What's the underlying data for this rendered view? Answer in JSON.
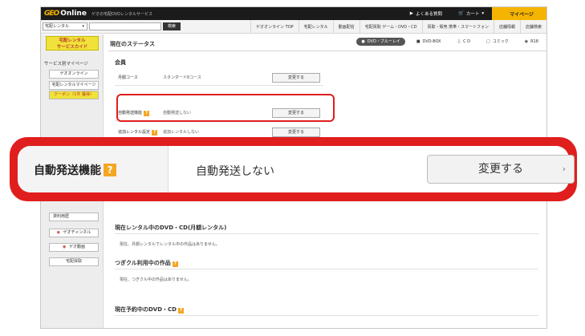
{
  "header": {
    "logo_mark": "GEO",
    "logo_text": "Online",
    "logo_tagline": "ゲオの宅配DVDレンタルサービス",
    "links": [
      {
        "icon": "help-icon",
        "label": "よくある質問"
      },
      {
        "icon": "cart-icon",
        "label": "カート"
      }
    ],
    "mypage_label": "マイページ"
  },
  "navbar": {
    "category_select": "宅配レンタル",
    "search_button": "検索",
    "items": [
      "ゲオオンライン TOP",
      "宅配レンタル",
      "動画配信",
      "宅配買取 ゲーム・DVD・CD",
      "買取・販売 携帯・スマートフォン",
      "店舗情報",
      "店舗検索"
    ]
  },
  "sidebar": {
    "badge_line1": "宅配レンタル",
    "badge_line2": "サービスカイド",
    "service_mypage": "サービス別マイページ",
    "btn_geo_online": "ゲオオンライン",
    "btn_rental_mypage": "宅配レンタルマイページ",
    "btn_coupon": "クーポン（1件 獲得）",
    "btn_history": "貸利用歴",
    "btn_geo_channel": "ゲオチャンネル",
    "btn_geo_douga": "ゲオ動画",
    "btn_takuhai_kaitori": "宅配買取"
  },
  "main": {
    "status_title": "現在のステータス",
    "tabs": [
      {
        "icon": "disc-icon",
        "label": "DVD・ブルーレイ",
        "active": true
      },
      {
        "icon": "box-icon",
        "label": "DVD-BOX",
        "active": false
      },
      {
        "icon": "music-icon",
        "label": "C D",
        "active": false
      },
      {
        "icon": "comic-icon",
        "label": "コミック",
        "active": false
      },
      {
        "icon": "r18-icon",
        "label": "R18",
        "active": false
      }
    ],
    "member_title": "会員",
    "rows": [
      {
        "label": "月額コース",
        "value": "スタンダード8コース",
        "button": "変更する"
      },
      {
        "label": "自動発送機能",
        "value": "自動発送しない",
        "button": "変更する"
      },
      {
        "label": "追加レンタル設定",
        "value": "追加レンタルしない",
        "button": "変更する"
      }
    ],
    "rental_title": "現在レンタル中のDVD・CD(月額レンタル)",
    "rental_text": "現在、月額レンタルでレンタル中の作品はありません。",
    "tsugikuru_title": "つぎクル利用中の作品",
    "tsugikuru_text": "現在、つぎクル中の作品はありません。",
    "reserve_title": "現在予約中のDVD・CD"
  },
  "callout": {
    "label": "自動発送機能",
    "value": "自動発送しない",
    "button": "変更する",
    "help_glyph": "?"
  },
  "colors": {
    "highlight": "#e01e1e",
    "accent": "#f5b400",
    "help_badge": "#f5a623"
  }
}
